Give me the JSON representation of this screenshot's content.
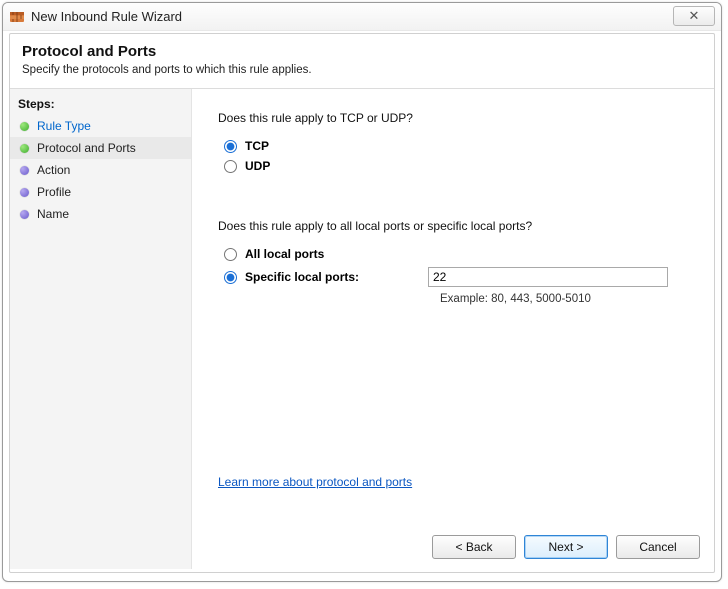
{
  "window": {
    "title": "New Inbound Rule Wizard",
    "close_glyph": "✕"
  },
  "header": {
    "title": "Protocol and Ports",
    "subtitle": "Specify the protocols and ports to which this rule applies."
  },
  "sidebar": {
    "title": "Steps:",
    "items": [
      {
        "label": "Rule Type",
        "state": "done",
        "link": true
      },
      {
        "label": "Protocol and Ports",
        "state": "done",
        "active": true
      },
      {
        "label": "Action",
        "state": "pending"
      },
      {
        "label": "Profile",
        "state": "pending"
      },
      {
        "label": "Name",
        "state": "pending"
      }
    ]
  },
  "main": {
    "q1": "Does this rule apply to TCP or UDP?",
    "protocol": {
      "tcp_label": "TCP",
      "udp_label": "UDP",
      "selected": "tcp"
    },
    "q2": "Does this rule apply to all local ports or specific local ports?",
    "ports": {
      "all_label": "All local ports",
      "specific_label": "Specific local ports:",
      "selected": "specific",
      "value": "22",
      "example": "Example: 80, 443, 5000-5010"
    },
    "learn_more": "Learn more about protocol and ports"
  },
  "buttons": {
    "back": "< Back",
    "next": "Next >",
    "cancel": "Cancel"
  }
}
